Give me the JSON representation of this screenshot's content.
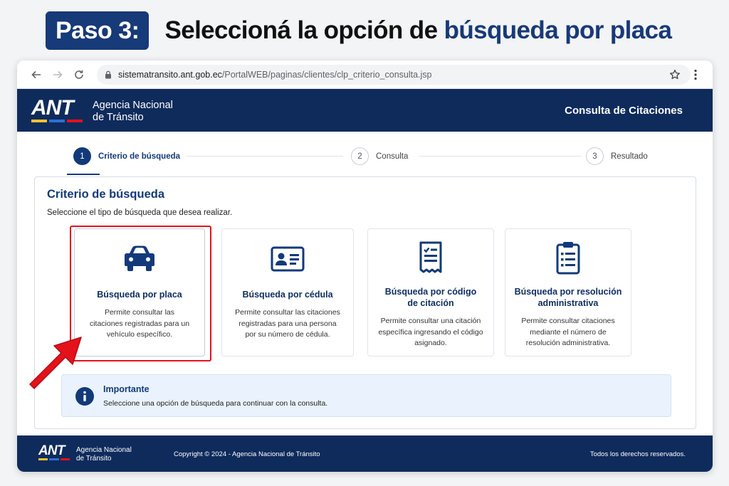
{
  "headline": {
    "step_badge": "Paso 3:",
    "text_prefix": "Seleccioná la opción de ",
    "text_highlight": "búsqueda por placa"
  },
  "browser": {
    "url_host": "sistematransito.ant.gob.ec",
    "url_path": "/PortalWEB/paginas/clientes/clp_criterio_consulta.jsp"
  },
  "header": {
    "logo_text": "ANT",
    "agency_line1": "Agencia Nacional",
    "agency_line2": "de Tránsito",
    "title": "Consulta de Citaciones"
  },
  "stepper": {
    "steps": [
      {
        "number": "1",
        "label": "Criterio de búsqueda",
        "active": true
      },
      {
        "number": "2",
        "label": "Consulta",
        "active": false
      },
      {
        "number": "3",
        "label": "Resultado",
        "active": false
      }
    ]
  },
  "panel": {
    "title": "Criterio de búsqueda",
    "subtitle": "Seleccione el tipo de búsqueda que desea realizar.",
    "cards": [
      {
        "icon": "car-icon",
        "title": "Búsqueda por placa",
        "description": "Permite consultar las citaciones registradas para un vehículo específico.",
        "selected": true
      },
      {
        "icon": "id-card-icon",
        "title": "Búsqueda por cédula",
        "description": "Permite consultar las citaciones registradas para una persona por su número de cédula.",
        "selected": false
      },
      {
        "icon": "receipt-icon",
        "title": "Búsqueda por código de citación",
        "description": "Permite consultar una citación específica ingresando el código asignado.",
        "selected": false
      },
      {
        "icon": "clipboard-icon",
        "title": "Búsqueda por resolución administrativa",
        "description": "Permite consultar citaciones mediante el número de resolución administrativa.",
        "selected": false
      }
    ]
  },
  "notice": {
    "title": "Importante",
    "text": "Seleccione una opción de búsqueda para continuar con la consulta."
  },
  "footer": {
    "logo_text": "ANT",
    "agency_line1": "Agencia Nacional",
    "agency_line2": "de Tránsito",
    "copyright": "Copyright © 2024 - Agencia Nacional de Tránsito",
    "rights": "Todos los derechos reservados."
  },
  "colors": {
    "brand_navy": "#0e2b5c",
    "accent_blue": "#123a7a",
    "highlight_red": "#e3121b",
    "logo_stripes": [
      "#f2c230",
      "#2f6fd6",
      "#e3121b"
    ]
  }
}
